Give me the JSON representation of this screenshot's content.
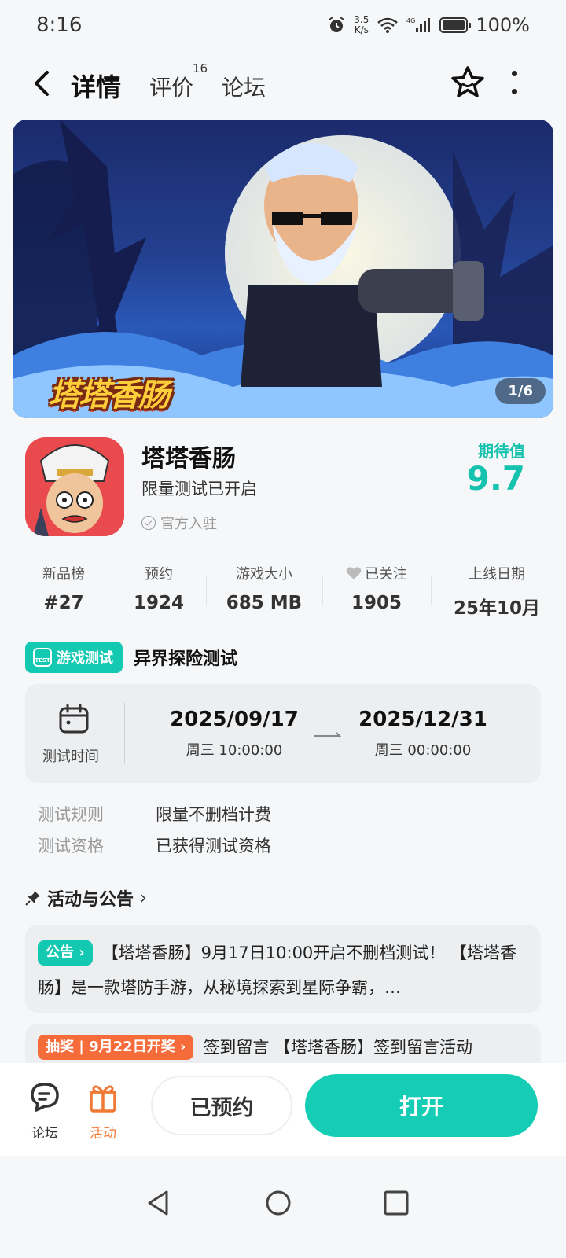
{
  "status_bar": {
    "time": "8:16",
    "speed_top": "3.5",
    "speed_bottom": "K/s",
    "network": "4G",
    "battery": "100%"
  },
  "nav": {
    "tabs": [
      {
        "label": "详情"
      },
      {
        "label": "评价",
        "count": "16"
      },
      {
        "label": "论坛"
      }
    ]
  },
  "banner": {
    "logo_text": "塔塔香肠",
    "counter": "1/6"
  },
  "app": {
    "name": "塔塔香肠",
    "subtitle": "限量测试已开启",
    "official": "官方入驻",
    "expect_label": "期待值",
    "expect_value": "9.7"
  },
  "stats": [
    {
      "label": "新品榜",
      "value": "#27"
    },
    {
      "label": "预约",
      "value": "1924"
    },
    {
      "label": "游戏大小",
      "value": "685 MB"
    },
    {
      "label": "已关注",
      "value": "1905"
    },
    {
      "label": "上线日期",
      "value": "25年10月"
    }
  ],
  "test": {
    "badge": "游戏测试",
    "badge_icon_text": "TEST",
    "title": "异界探险测试",
    "time_label": "测试时间",
    "start_date": "2025/09/17",
    "start_time": "周三  10:00:00",
    "end_date": "2025/12/31",
    "end_time": "周三  00:00:00",
    "rules": [
      {
        "key": "测试规则",
        "value": "限量不删档计费"
      },
      {
        "key": "测试资格",
        "value": "已获得测试资格"
      }
    ]
  },
  "activities": {
    "title": "活动与公告",
    "notice": {
      "badge": "公告",
      "text": "【塔塔香肠】9月17日10:00开启不删档测试！ 【塔塔香肠】是一款塔防手游，从秘境探索到星际争霸，…"
    },
    "lottery": {
      "badge": "抽奖 | 9月22日开奖",
      "text": "签到留言 【塔塔香肠】签到留言活动"
    }
  },
  "bottom": {
    "forum_label": "论坛",
    "activity_label": "活动",
    "reserved_label": "已预约",
    "open_label": "打开"
  },
  "colors": {
    "accent": "#14cdb4",
    "orange": "#f56b3a"
  }
}
